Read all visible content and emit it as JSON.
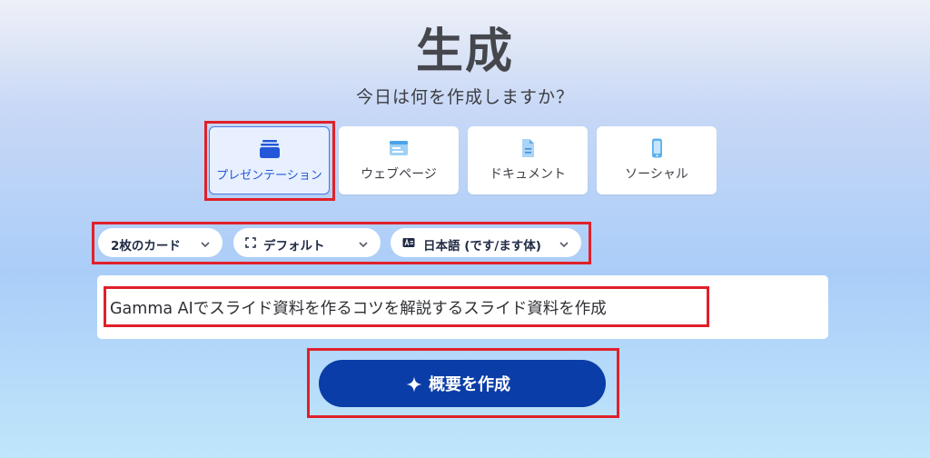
{
  "page": {
    "title": "生成",
    "subtitle": "今日は何を作成しますか？"
  },
  "type_cards": [
    {
      "label": "プレゼンテーション",
      "icon": "presentation-icon",
      "selected": true
    },
    {
      "label": "ウェブページ",
      "icon": "webpage-icon",
      "selected": false
    },
    {
      "label": "ドキュメント",
      "icon": "document-icon",
      "selected": false
    },
    {
      "label": "ソーシャル",
      "icon": "phone-icon",
      "selected": false
    }
  ],
  "options": {
    "card_count": "2枚のカード",
    "theme": "デフォルト",
    "language": "日本語 (です/ます体)"
  },
  "prompt": {
    "text": "Gamma AIでスライド資料を作るコツを解説するスライド資料を作成"
  },
  "generate_button": {
    "label": "概要を作成",
    "icon": "sparkle-icon"
  },
  "colors": {
    "accent": "#0b3da8",
    "selected_text": "#2357d9",
    "highlight_box": "#e0202a"
  }
}
